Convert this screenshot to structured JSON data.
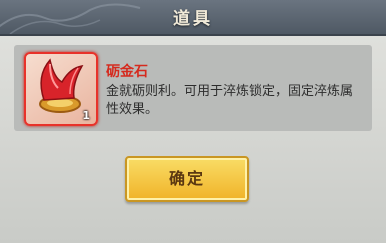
{
  "dialog": {
    "title": "道具",
    "item": {
      "name": "砺金石",
      "description": "金就砺则利。可用于淬炼锁定，固定淬炼属性效果。",
      "count": "1",
      "icon": "whetstone-gem-icon"
    },
    "confirm_label": "确定"
  },
  "colors": {
    "title_bar": "#5c6670",
    "panel": "#d6d7d3",
    "item_name": "#d52a1e",
    "icon_border": "#e8322a",
    "button": "#f2c23a"
  }
}
